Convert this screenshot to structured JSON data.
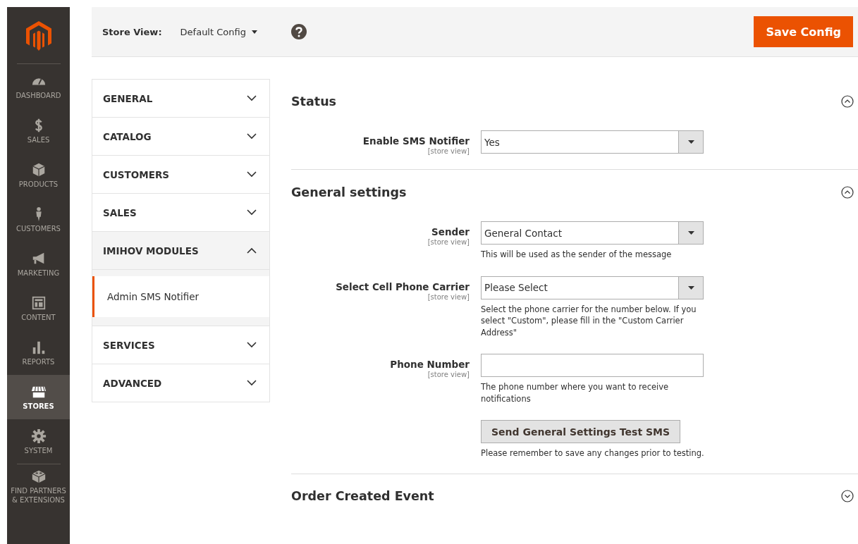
{
  "nav": [
    {
      "kind": "dashboard",
      "label": "DASHBOARD",
      "selected": false
    },
    {
      "kind": "sales",
      "label": "SALES",
      "selected": false
    },
    {
      "kind": "products",
      "label": "PRODUCTS",
      "selected": false
    },
    {
      "kind": "customers",
      "label": "CUSTOMERS",
      "selected": false
    },
    {
      "kind": "marketing",
      "label": "MARKETING",
      "selected": false
    },
    {
      "kind": "content",
      "label": "CONTENT",
      "selected": false
    },
    {
      "kind": "reports",
      "label": "REPORTS",
      "selected": false
    },
    {
      "kind": "stores",
      "label": "STORES",
      "selected": true
    },
    {
      "kind": "system",
      "label": "SYSTEM",
      "selected": false
    },
    {
      "kind": "partners",
      "label": "FIND PARTNERS & EXTENSIONS",
      "selected": false
    }
  ],
  "header": {
    "scope_label": "Store View:",
    "scope_value": "Default Config",
    "save_button": "Save Config"
  },
  "config_tabs": [
    {
      "label": "GENERAL",
      "expanded": false
    },
    {
      "label": "CATALOG",
      "expanded": false
    },
    {
      "label": "CUSTOMERS",
      "expanded": false
    },
    {
      "label": "SALES",
      "expanded": false
    },
    {
      "label": "IMIHOV MODULES",
      "expanded": true,
      "children": [
        {
          "label": "Admin SMS Notifier",
          "selected": true
        }
      ]
    },
    {
      "label": "SERVICES",
      "expanded": false
    },
    {
      "label": "ADVANCED",
      "expanded": false
    }
  ],
  "sections": [
    {
      "title": "Status",
      "expanded": true,
      "fields": [
        {
          "kind": "select",
          "label": "Enable SMS Notifier",
          "scope": "[store view]",
          "value": "Yes"
        }
      ]
    },
    {
      "title": "General settings",
      "expanded": true,
      "fields": [
        {
          "kind": "select",
          "label": "Sender",
          "scope": "[store view]",
          "value": "General Contact",
          "note": "This will be used as the sender of the message"
        },
        {
          "kind": "select",
          "label": "Select Cell Phone Carrier",
          "scope": "[store view]",
          "value": "Please Select",
          "note": "Select the phone carrier for the number below. If you select \"Custom\", please fill in the \"Custom Carrier Address\""
        },
        {
          "kind": "text",
          "label": "Phone Number",
          "scope": "[store view]",
          "note": "The phone number where you want to receive notifications"
        },
        {
          "kind": "button",
          "label": "Send General Settings Test SMS",
          "note": "Please remember to save any changes prior to testing."
        }
      ]
    },
    {
      "title": "Order Created Event",
      "expanded": false
    }
  ]
}
